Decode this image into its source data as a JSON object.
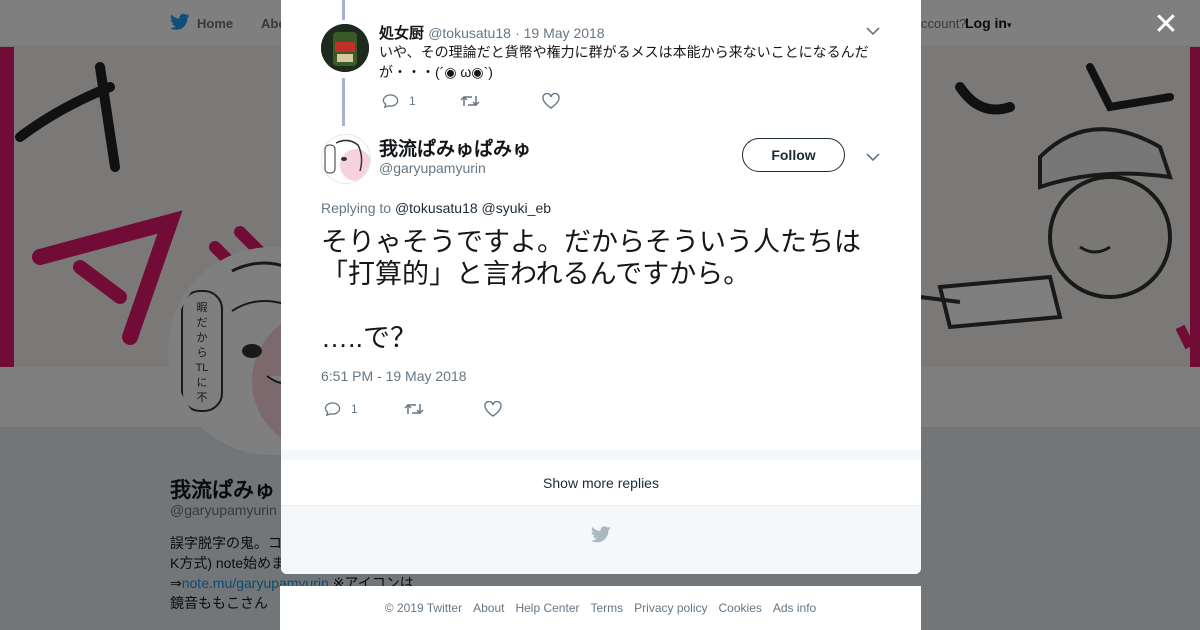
{
  "nav": {
    "home_label": "Home",
    "about_label": "Abo",
    "have_account_label": "ccount?",
    "login_label": "Log in"
  },
  "background_profile": {
    "name": "我流ぱみゅ",
    "handle": "@garyupamyurin",
    "bio_line1": "誤字脱字の鬼。コ",
    "bio_line2": "K方式) note始めま",
    "bio_arrow": "⇒",
    "bio_link": "note.mu/garyupamyurin",
    "bio_link_suffix": " ※アイコンは",
    "bio_line4": "鏡音ももこさん"
  },
  "reply_tweet": {
    "name": "処女厨",
    "handle": "@tokusatu18",
    "date": "19 May 2018",
    "text": "いや、その理論だと貨幣や権力に群がるメスは本能から来ないことになるんだが・・・(´◉ ω◉`)",
    "reply_count": "1",
    "retweet_count": "",
    "like_count": ""
  },
  "main_tweet": {
    "name": "我流ぱみゅぱみゅ",
    "handle": "@garyupamyurin",
    "follow_label": "Follow",
    "replying_to_label": "Replying to",
    "replying_to_1": "@tokusatu18",
    "replying_to_2": "@syuki_eb",
    "text": "そりゃそうですよ。だからそういう人たちは「打算的」と言われるんですから。",
    "text2": "…..で？",
    "timestamp": "6:51 PM - 19 May 2018",
    "reply_count": "1",
    "retweet_count": "",
    "like_count": ""
  },
  "show_more_label": "Show more replies",
  "footer": {
    "links": [
      "© 2019 Twitter",
      "About",
      "Help Center",
      "Terms",
      "Privacy policy",
      "Cookies",
      "Ads info"
    ]
  },
  "colors": {
    "twitter_blue": "#1da1f2",
    "banner_pink": "#e2196e",
    "thread_line": "#a3b4d3",
    "text_gray": "#657786"
  },
  "icons": [
    "twitter-bird-icon",
    "close-icon",
    "chevron-down-icon",
    "reply-icon",
    "retweet-icon",
    "like-icon"
  ]
}
